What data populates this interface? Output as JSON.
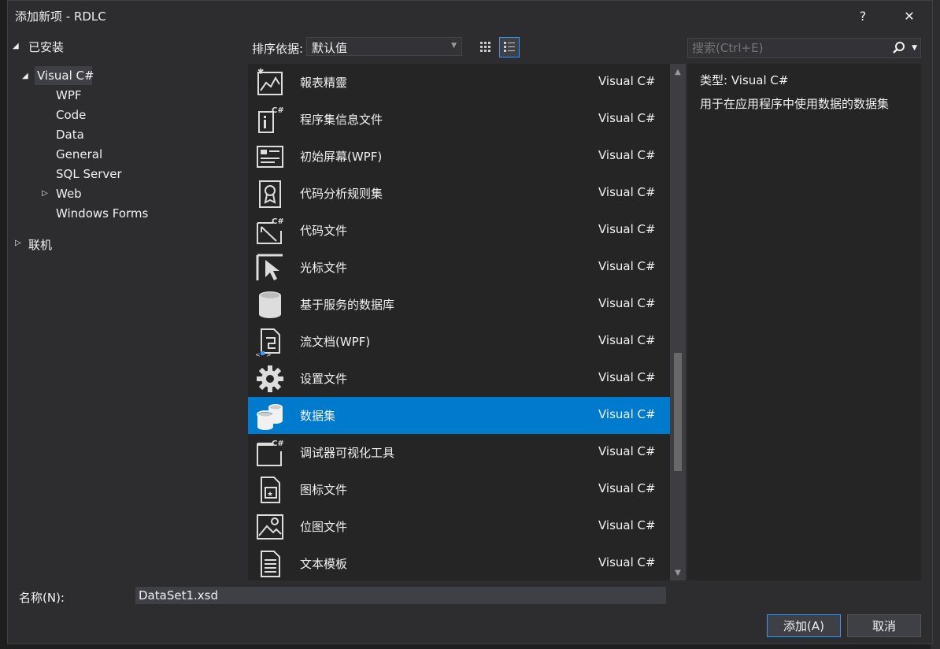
{
  "window": {
    "title": "添加新项 - RDLC",
    "help_label": "?",
    "close_label": "✕"
  },
  "tree": {
    "installed_label": "已安装",
    "visual_csharp_label": "Visual C#",
    "children": [
      "WPF",
      "Code",
      "Data",
      "General",
      "SQL Server",
      "Web",
      "Windows Forms"
    ],
    "online_label": "联机"
  },
  "sort": {
    "label": "排序依据:",
    "selected": "默认值"
  },
  "search": {
    "placeholder": "搜索(Ctrl+E)"
  },
  "items": [
    {
      "name": "報表精靈",
      "lang": "Visual C#",
      "icon": "report-wizard-icon"
    },
    {
      "name": "程序集信息文件",
      "lang": "Visual C#",
      "icon": "assembly-info-icon"
    },
    {
      "name": "初始屏幕(WPF)",
      "lang": "Visual C#",
      "icon": "splash-screen-icon"
    },
    {
      "name": "代码分析规则集",
      "lang": "Visual C#",
      "icon": "ruleset-icon"
    },
    {
      "name": "代码文件",
      "lang": "Visual C#",
      "icon": "code-file-icon"
    },
    {
      "name": "光标文件",
      "lang": "Visual C#",
      "icon": "cursor-file-icon"
    },
    {
      "name": "基于服务的数据库",
      "lang": "Visual C#",
      "icon": "database-icon"
    },
    {
      "name": "流文档(WPF)",
      "lang": "Visual C#",
      "icon": "flow-document-icon"
    },
    {
      "name": "设置文件",
      "lang": "Visual C#",
      "icon": "settings-gear-icon"
    },
    {
      "name": "数据集",
      "lang": "Visual C#",
      "icon": "dataset-icon"
    },
    {
      "name": "调试器可视化工具",
      "lang": "Visual C#",
      "icon": "debugger-visualizer-icon"
    },
    {
      "name": "图标文件",
      "lang": "Visual C#",
      "icon": "icon-file-icon"
    },
    {
      "name": "位图文件",
      "lang": "Visual C#",
      "icon": "bitmap-file-icon"
    },
    {
      "name": "文本模板",
      "lang": "Visual C#",
      "icon": "text-template-icon"
    }
  ],
  "selected_item": "数据集",
  "description": {
    "type_label": "类型:",
    "type_value": "Visual C#",
    "text": "用于在应用程序中使用数据的数据集"
  },
  "name_field": {
    "label": "名称(N):",
    "value": "DataSet1.xsd"
  },
  "buttons": {
    "add": "添加(A)",
    "cancel": "取消"
  },
  "colors": {
    "accent": "#007acc",
    "background": "#2d2d30",
    "panel": "#252526"
  }
}
